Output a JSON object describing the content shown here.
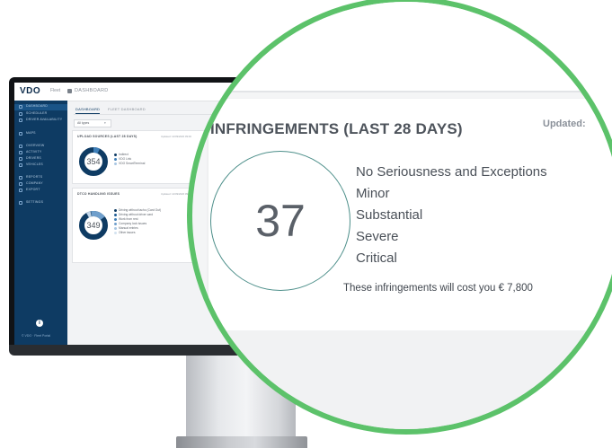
{
  "app": {
    "logo": "VDO",
    "logo_sub": "Fleet",
    "breadcrumb": "DASHBOARD"
  },
  "sidebar": {
    "items": [
      {
        "label": "DASHBOARD",
        "active": true
      },
      {
        "label": "SCHEDULER",
        "active": false
      },
      {
        "label": "DRIVER AVAILABILITY",
        "active": false
      },
      {
        "label": "MAPS",
        "active": false
      },
      {
        "label": "OVERVIEW",
        "active": false
      },
      {
        "label": "ACTIVITY",
        "active": false
      },
      {
        "label": "DRIVERS",
        "active": false
      },
      {
        "label": "VEHICLES",
        "active": false
      },
      {
        "label": "REPORTS",
        "active": false
      },
      {
        "label": "COMPANY",
        "active": false
      },
      {
        "label": "EXPORT",
        "active": false
      },
      {
        "label": "SETTINGS",
        "active": false
      }
    ],
    "footer": "© VDO · Fleet Portal"
  },
  "tabs": [
    {
      "label": "DASHBOARD",
      "active": true
    },
    {
      "label": "FLEET DASHBOARD",
      "active": false
    }
  ],
  "filter": {
    "value": "All types",
    "chevron": "▾"
  },
  "cards": {
    "upload": {
      "title": "UPLOAD SOURCES (LAST 28 DAYS)",
      "updated": "Updated: 14/09/2020 09:00",
      "total": "354",
      "legend": [
        "Indirect",
        "VDO Link",
        "VDO SmartTerminal"
      ]
    },
    "handling": {
      "title": "DTCO HANDLING ISSUES",
      "updated": "Updated: 14/09/2020 09:00",
      "total": "349",
      "legend": [
        "Driving without tacho (Card Out)",
        "Driving without driver card",
        "Work from rest",
        "Company lock issues",
        "Manual entries",
        "Other issues"
      ]
    }
  },
  "zoom": {
    "title": "INFRINGEMENTS (LAST 28 DAYS)",
    "updated": "Updated:",
    "count": "37",
    "categories": [
      "No Seriousness and Exceptions",
      "Minor",
      "Substantial",
      "Severe",
      "Critical"
    ],
    "cost_text": "These infringements will cost you € 7,800"
  },
  "colors": {
    "sidebar": "#0e3b63",
    "accent_green": "#5cc26a",
    "donut_dark": "#0e3b63",
    "donut_mid": "#3f7fb8",
    "donut_light": "#a8c6e2"
  },
  "icons": {
    "info": "i"
  }
}
